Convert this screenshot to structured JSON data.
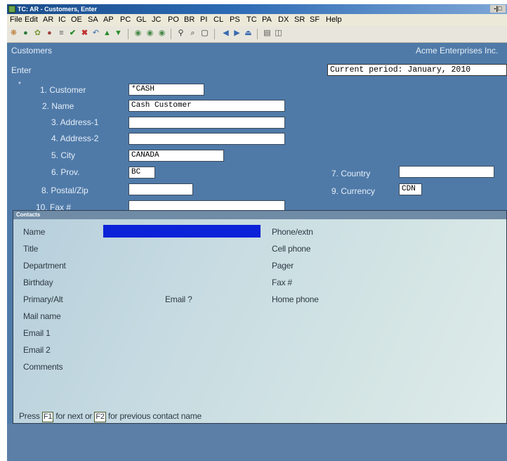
{
  "window": {
    "title": "TC: AR - Customers, Enter",
    "sys_buttons": "-|□"
  },
  "menu": [
    "File",
    "Edit",
    "AR",
    "IC",
    "OE",
    "SA",
    "AP",
    "PC",
    "GL",
    "JC",
    "PO",
    "BR",
    "PI",
    "CL",
    "PS",
    "TC",
    "PA",
    "DX",
    "SR",
    "SF",
    "Help"
  ],
  "toolbar_icons": [
    "logo-icon",
    "refresh-icon",
    "palette-icon",
    "stop-icon",
    "list-icon",
    "check-icon",
    "cancel-icon",
    "undo-icon",
    "up-icon",
    "down-icon",
    "circle-left-icon",
    "circle-mid-icon",
    "circle-right-icon",
    "binoculars-icon",
    "zoom-icon",
    "doc-icon",
    "prev-icon",
    "next-icon",
    "last-icon",
    "save-icon",
    "preview-icon"
  ],
  "header": {
    "screen": "Customers",
    "company": "Acme Enterprises Inc.",
    "mode": "Enter",
    "period": "Current period: January, 2010"
  },
  "marker": "*",
  "fields": {
    "customer": {
      "label": "1. Customer",
      "value": "*CASH"
    },
    "name": {
      "label": "2. Name",
      "value": "Cash Customer"
    },
    "address1": {
      "label": "3. Address-1",
      "value": ""
    },
    "address2": {
      "label": "4. Address-2",
      "value": ""
    },
    "city": {
      "label": "5. City",
      "value": "CANADA"
    },
    "prov": {
      "label": "6. Prov.",
      "value": "BC"
    },
    "postal": {
      "label": "8. Postal/Zip",
      "value": ""
    },
    "fax": {
      "label": "10. Fax #",
      "value": ""
    },
    "country": {
      "label": "7. Country",
      "value": ""
    },
    "currency": {
      "label": "9. Currency",
      "value": "CDN"
    }
  },
  "contacts": {
    "title": "Contacts",
    "left_labels": [
      "Name",
      "Title",
      "Department",
      "Birthday",
      "Primary/Alt",
      "Mail name",
      "Email 1",
      "Email 2",
      "Comments"
    ],
    "middle_label": "Email ?",
    "right_labels": [
      "Phone/extn",
      "Cell phone",
      "Pager",
      "Fax #",
      "Home phone"
    ],
    "footer": {
      "press": "Press",
      "f1": "F1",
      "mid": "for next or",
      "f2": "F2",
      "end": "for previous contact name"
    }
  }
}
